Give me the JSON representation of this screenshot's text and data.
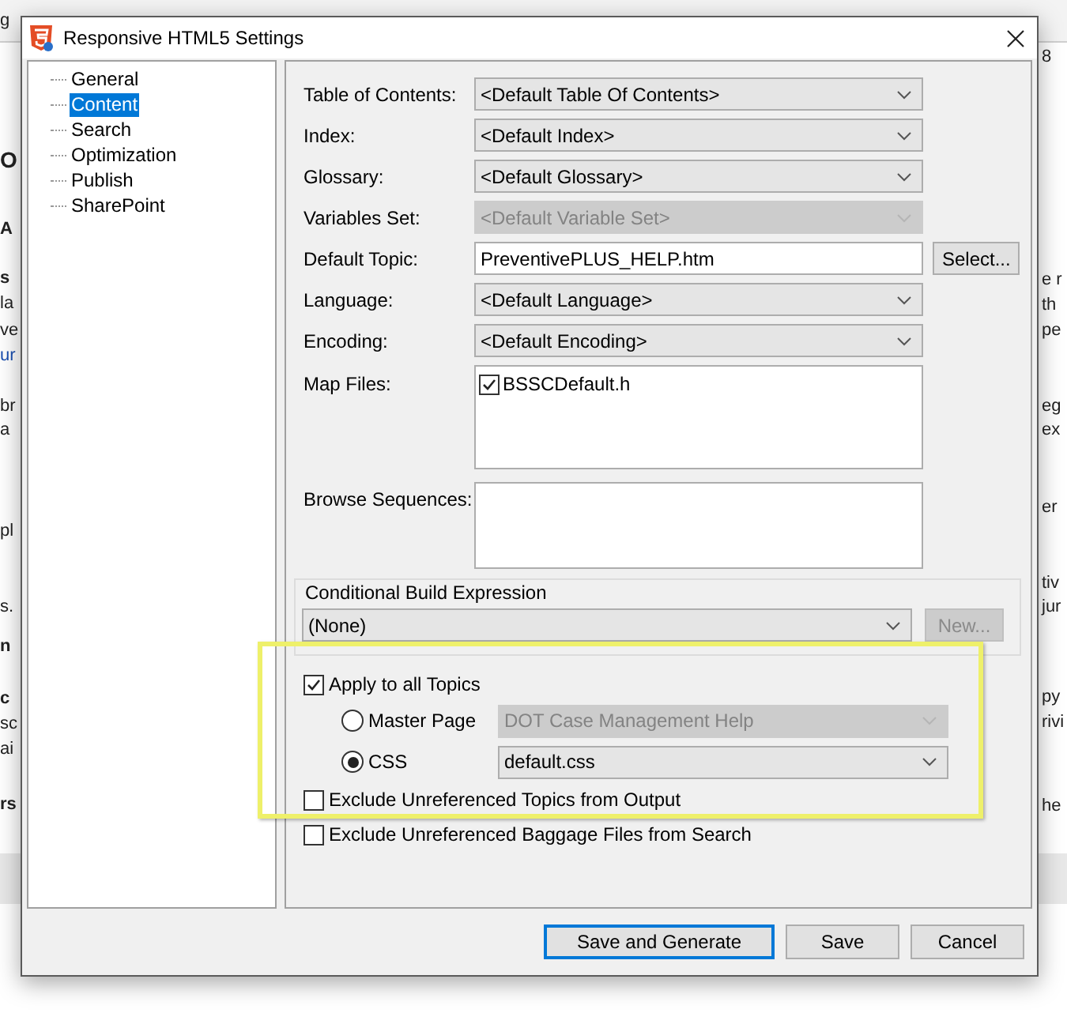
{
  "background": {
    "left_fragments": [
      {
        "text": "g",
        "kind": "plain"
      },
      {
        "text": "O",
        "kind": "heading"
      },
      {
        "text": "A",
        "kind": "bold"
      },
      {
        "text": "s",
        "kind": "bold"
      },
      {
        "text": "la",
        "kind": "plain"
      },
      {
        "text": "ve",
        "kind": "plain"
      },
      {
        "text": "ur",
        "kind": "link"
      },
      {
        "text": "br",
        "kind": "plain"
      },
      {
        "text": "a",
        "kind": "plain"
      },
      {
        "text": "pl",
        "kind": "plain"
      },
      {
        "text": "s.",
        "kind": "plain"
      },
      {
        "text": "n",
        "kind": "bold"
      },
      {
        "text": "c",
        "kind": "bold"
      },
      {
        "text": "sc",
        "kind": "plain"
      },
      {
        "text": "ai",
        "kind": "plain"
      },
      {
        "text": "rs",
        "kind": "bold"
      }
    ],
    "right_fragments": [
      {
        "text": "8"
      },
      {
        "text": "e r"
      },
      {
        "text": "th"
      },
      {
        "text": "pe"
      },
      {
        "text": "eg"
      },
      {
        "text": "ex"
      },
      {
        "text": "er"
      },
      {
        "text": "tiv"
      },
      {
        "text": "jur"
      },
      {
        "text": "py"
      },
      {
        "text": "rivi"
      },
      {
        "text": "he"
      }
    ]
  },
  "window": {
    "title": "Responsive HTML5 Settings"
  },
  "sidebar": {
    "items": [
      {
        "label": "General",
        "selected": false
      },
      {
        "label": "Content",
        "selected": true
      },
      {
        "label": "Search",
        "selected": false
      },
      {
        "label": "Optimization",
        "selected": false
      },
      {
        "label": "Publish",
        "selected": false
      },
      {
        "label": "SharePoint",
        "selected": false
      }
    ]
  },
  "form": {
    "rows": [
      {
        "kind": "combo",
        "label": "Table of Contents:",
        "value": "<Default Table Of Contents>",
        "disabled": false
      },
      {
        "kind": "combo",
        "label": "Index:",
        "value": "<Default Index>",
        "disabled": false
      },
      {
        "kind": "combo",
        "label": "Glossary:",
        "value": "<Default Glossary>",
        "disabled": false
      },
      {
        "kind": "combo",
        "label": "Variables Set:",
        "value": "<Default Variable Set>",
        "disabled": true
      },
      {
        "kind": "text",
        "label": "Default Topic:",
        "value": "PreventivePLUS_HELP.htm",
        "button": "Select..."
      },
      {
        "kind": "combo",
        "label": "Language:",
        "value": "<Default Language>",
        "disabled": false
      },
      {
        "kind": "combo",
        "label": "Encoding:",
        "value": "<Default Encoding>",
        "disabled": false
      },
      {
        "kind": "checklist",
        "label": "Map Files:",
        "items": [
          {
            "label": "BSSCDefault.h",
            "checked": true
          }
        ]
      },
      {
        "kind": "list",
        "label": "Browse Sequences:"
      }
    ],
    "conditional": {
      "title": "Conditional Build Expression",
      "value": "(None)",
      "button": {
        "label": "New...",
        "disabled": true
      }
    },
    "apply_all": {
      "label": "Apply to all Topics",
      "checked": true
    },
    "choices": [
      {
        "label": "Master Page",
        "selected": false,
        "value": "DOT Case Management Help",
        "disabled": true
      },
      {
        "label": "CSS",
        "selected": true,
        "value": "default.css",
        "disabled": false
      }
    ],
    "excludes": [
      {
        "label": "Exclude Unreferenced Topics from Output",
        "checked": false
      },
      {
        "label": "Exclude Unreferenced Baggage Files from Search",
        "checked": false
      }
    ]
  },
  "buttons": [
    {
      "label": "Save and Generate",
      "default": true
    },
    {
      "label": "Save",
      "default": false
    },
    {
      "label": "Cancel",
      "default": false
    }
  ]
}
